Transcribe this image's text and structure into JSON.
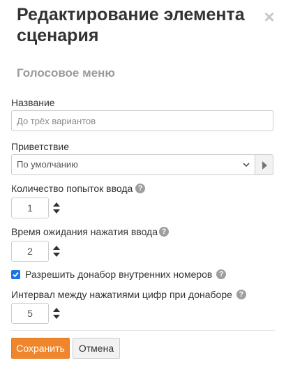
{
  "dialog": {
    "title": "Редактирование элемента сценария",
    "close_glyph": "×",
    "subtitle": "Голосовое меню"
  },
  "fields": {
    "name": {
      "label": "Название",
      "value": "",
      "placeholder": "До трёх вариантов"
    },
    "greeting": {
      "label": "Приветствие",
      "selected": "По умолчанию"
    },
    "attempts": {
      "label": "Количество попыток ввода",
      "value": "1"
    },
    "wait_time": {
      "label": "Время ожидания нажатия ввода",
      "value": "2"
    },
    "allow_dial": {
      "label": "Разрешить донабор внутренних номеров",
      "checked": true
    },
    "dial_interval": {
      "label": "Интервал между нажатиями цифр при донаборе",
      "value": "5"
    }
  },
  "help_glyph": "?",
  "buttons": {
    "save": "Сохранить",
    "cancel": "Отмена"
  },
  "colors": {
    "accent": "#f0862c",
    "checkbox": "#1a73e8",
    "subtitle": "#9a9a9a"
  },
  "icons": [
    "close-icon",
    "chevron-down-icon",
    "play-icon",
    "help-icon",
    "spinner-icon",
    "checkmark-icon"
  ]
}
